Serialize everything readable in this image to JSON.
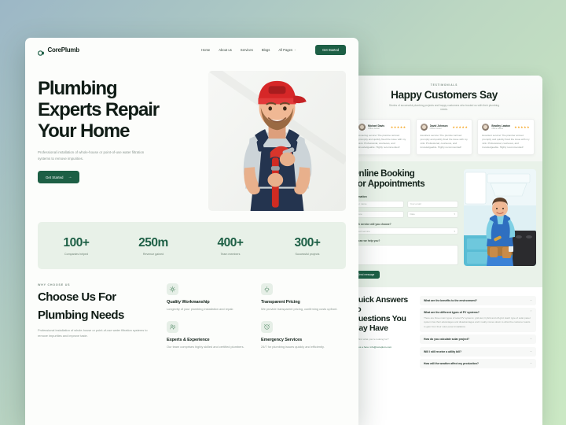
{
  "brand": {
    "name": "CorePlumb",
    "accent": "#1d5f45",
    "accent_light": "#e8f1e8"
  },
  "nav": {
    "links": [
      {
        "label": "Home"
      },
      {
        "label": "About us"
      },
      {
        "label": "Services"
      },
      {
        "label": "Blogs"
      },
      {
        "label": "All Pages"
      }
    ],
    "dropdown_caret": "⌄",
    "cta": "Get Started"
  },
  "hero": {
    "heading_line1": "Plumbing",
    "heading_line2": "Experts Repair",
    "heading_line3": "Your Home",
    "paragraph": "Professional installation of whole-house or point-of-use water filtration systems to remove impurities.",
    "button": "Get Started",
    "button_arrow": "→",
    "image_alt": "plumber-with-wrench-photo"
  },
  "stats": [
    {
      "number": "100+",
      "label": "Companies helped"
    },
    {
      "number": "250m",
      "label": "Revenue gained"
    },
    {
      "number": "400+",
      "label": "Team members"
    },
    {
      "number": "300+",
      "label": "Successful projects"
    }
  ],
  "why_choose": {
    "eyebrow": "WHY CHOOSE US",
    "heading_line1": "Choose Us For",
    "heading_line2": "Plumbing Needs",
    "paragraph": "Professional installation of whole-house or point-of-use water filtration systems to remove impurities and improve taste.",
    "features": [
      {
        "icon": "valve-icon",
        "title": "Quality Workmanship",
        "desc": "Longevity of your plumbing installation and repair."
      },
      {
        "icon": "pipes-icon",
        "title": "Transparent Pricing",
        "desc": "We provide transparent pricing, confirming costs upfront."
      },
      {
        "icon": "team-icon",
        "title": "Experts & Experience",
        "desc": "Our team comprises highly skilled and certified plumbers."
      },
      {
        "icon": "emergency-icon",
        "title": "Emergency Services",
        "desc": "24/7 for plumbing issues quickly and efficiently."
      }
    ]
  },
  "testimonials": {
    "eyebrow": "TESTIMONIALS",
    "title": "Happy Customers Say",
    "subtitle": "Stories of successful plumbing projects and happy customers who trusted us with their plumbing needs.",
    "cards": [
      {
        "name": "Michael Davis",
        "role": "Office owner",
        "stars": "★★★★★",
        "quote": "Amazing service! The plumber arrived promptly and quickly fixed the issue with my sink. Professional, courteous, and knowledgeable. Highly recommended!"
      },
      {
        "name": "David Johnson",
        "role": "Office owner",
        "stars": "★★★★★",
        "quote": "Excellent service! The plumber arrived promptly and quickly fixed the issue with my sink. Professional, courteous, and knowledgeable. Highly recommended!"
      },
      {
        "name": "Bradley Lawton",
        "role": "Office owner",
        "stars": "★★★★★",
        "quote": "Excellent service! The plumber arrived promptly and quickly fixed the issue with my sink. Professional, courteous, and knowledgeable. Highly recommended!"
      }
    ]
  },
  "booking": {
    "title_line1": "Online Booking",
    "title_line2": "For Appointments",
    "section_label": "Information",
    "name_placeholder": "Your name",
    "email_placeholder": "Your email",
    "phone_placeholder": "Phone",
    "date_placeholder": "Date",
    "service_label": "Which service will you choose?",
    "service_placeholder": "Select service",
    "message_label": "How can we help you?",
    "submit": "Send message",
    "image_alt": "plumber-in-kitchen-photo"
  },
  "faq": {
    "title_line1": "Quick Answers To",
    "title_line2": "Questions You",
    "title_line3": "May Have",
    "note": "Can't find what you're looking for?",
    "note_link": "Write us a here: info@coreplum.com",
    "items": [
      {
        "q": "What are the benefits to the environment?",
        "a": "",
        "open": false,
        "caret": "⌄"
      },
      {
        "q": "What are the different types of PV systems?",
        "a": "There are three main types of solar PV systems: grid-tied, hybrid and off-grid. Each type of solar panel system has their advantages and disadvantages and it really comes down to what the customer wants to gain from their solar panel installation.",
        "open": true,
        "caret": "⌃"
      },
      {
        "q": "How do you calculate solar project?",
        "a": "",
        "open": false,
        "caret": "⌄"
      },
      {
        "q": "Will I still receive a utility bill?",
        "a": "",
        "open": false,
        "caret": "⌄"
      },
      {
        "q": "How will the weather affect my production?",
        "a": "",
        "open": false,
        "caret": "⌄"
      }
    ]
  }
}
